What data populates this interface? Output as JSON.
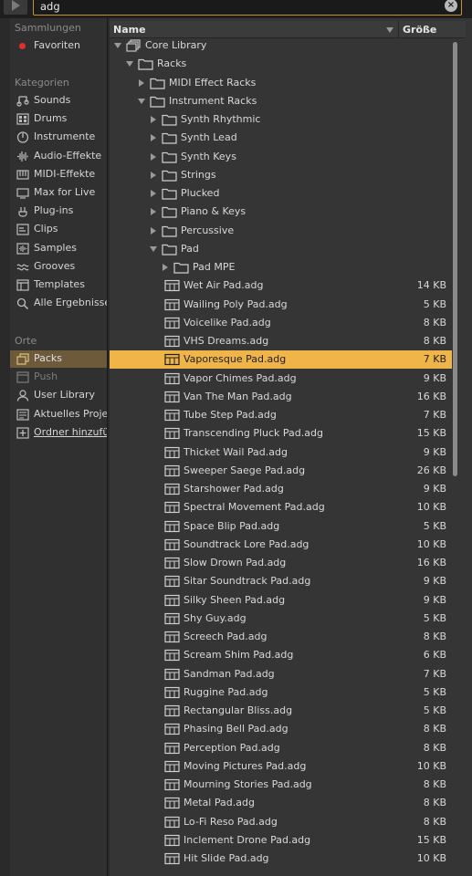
{
  "search": {
    "value": "adg"
  },
  "sidebar": {
    "sammlungen_head": "Sammlungen",
    "favoriten": "Favoriten",
    "kategorien_head": "Kategorien",
    "categories": [
      {
        "label": "Sounds",
        "icon": "sounds-icon"
      },
      {
        "label": "Drums",
        "icon": "drums-icon"
      },
      {
        "label": "Instrumente",
        "icon": "instruments-icon"
      },
      {
        "label": "Audio-Effekte",
        "icon": "audio-effects-icon"
      },
      {
        "label": "MIDI-Effekte",
        "icon": "midi-effects-icon"
      },
      {
        "label": "Max for Live",
        "icon": "max-for-live-icon"
      },
      {
        "label": "Plug-ins",
        "icon": "plugins-icon"
      },
      {
        "label": "Clips",
        "icon": "clips-icon"
      },
      {
        "label": "Samples",
        "icon": "samples-icon"
      },
      {
        "label": "Grooves",
        "icon": "grooves-icon"
      },
      {
        "label": "Templates",
        "icon": "templates-icon"
      },
      {
        "label": "Alle Ergebnisse",
        "icon": "search-icon"
      }
    ],
    "orte_head": "Orte",
    "places": [
      {
        "label": "Packs",
        "icon": "packs-icon"
      },
      {
        "label": "Push",
        "icon": "push-icon"
      },
      {
        "label": "User Library",
        "icon": "user-library-icon"
      },
      {
        "label": "Aktuelles Projekt",
        "icon": "current-project-icon"
      },
      {
        "label": "Ordner hinzufügen",
        "icon": "add-folder-icon"
      }
    ]
  },
  "columns": {
    "name": "Name",
    "size": "Größe"
  },
  "rows": [
    {
      "name": "Core Library",
      "size": "",
      "level": 0,
      "type": "library",
      "expanded": true
    },
    {
      "name": "Racks",
      "size": "",
      "level": 1,
      "type": "folder",
      "expanded": true
    },
    {
      "name": "MIDI Effect Racks",
      "size": "",
      "level": 2,
      "type": "folder",
      "expanded": false
    },
    {
      "name": "Instrument Racks",
      "size": "",
      "level": 2,
      "type": "folder",
      "expanded": true
    },
    {
      "name": "Synth Rhythmic",
      "size": "",
      "level": 3,
      "type": "folder",
      "expanded": false
    },
    {
      "name": "Synth Lead",
      "size": "",
      "level": 3,
      "type": "folder",
      "expanded": false
    },
    {
      "name": "Synth Keys",
      "size": "",
      "level": 3,
      "type": "folder",
      "expanded": false
    },
    {
      "name": "Strings",
      "size": "",
      "level": 3,
      "type": "folder",
      "expanded": false
    },
    {
      "name": "Plucked",
      "size": "",
      "level": 3,
      "type": "folder",
      "expanded": false
    },
    {
      "name": "Piano & Keys",
      "size": "",
      "level": 3,
      "type": "folder",
      "expanded": false
    },
    {
      "name": "Percussive",
      "size": "",
      "level": 3,
      "type": "folder",
      "expanded": false
    },
    {
      "name": "Pad",
      "size": "",
      "level": 3,
      "type": "folder",
      "expanded": true
    },
    {
      "name": "Pad MPE",
      "size": "",
      "level": 4,
      "type": "folder",
      "expanded": false
    },
    {
      "name": "Wet Air Pad.adg",
      "size": "14 KB",
      "level": 4,
      "type": "file"
    },
    {
      "name": "Wailing Poly Pad.adg",
      "size": "5 KB",
      "level": 4,
      "type": "file"
    },
    {
      "name": "Voicelike Pad.adg",
      "size": "8 KB",
      "level": 4,
      "type": "file"
    },
    {
      "name": "VHS Dreams.adg",
      "size": "8 KB",
      "level": 4,
      "type": "file"
    },
    {
      "name": "Vaporesque Pad.adg",
      "size": "7 KB",
      "level": 4,
      "type": "file",
      "selected": true
    },
    {
      "name": "Vapor Chimes Pad.adg",
      "size": "9 KB",
      "level": 4,
      "type": "file"
    },
    {
      "name": "Van The Man Pad.adg",
      "size": "16 KB",
      "level": 4,
      "type": "file"
    },
    {
      "name": "Tube Step Pad.adg",
      "size": "7 KB",
      "level": 4,
      "type": "file"
    },
    {
      "name": "Transcending Pluck Pad.adg",
      "size": "15 KB",
      "level": 4,
      "type": "file"
    },
    {
      "name": "Thicket Wail Pad.adg",
      "size": "9 KB",
      "level": 4,
      "type": "file"
    },
    {
      "name": "Sweeper Saege Pad.adg",
      "size": "26 KB",
      "level": 4,
      "type": "file"
    },
    {
      "name": "Starshower Pad.adg",
      "size": "9 KB",
      "level": 4,
      "type": "file"
    },
    {
      "name": "Spectral Movement Pad.adg",
      "size": "10 KB",
      "level": 4,
      "type": "file"
    },
    {
      "name": "Space Blip Pad.adg",
      "size": "5 KB",
      "level": 4,
      "type": "file"
    },
    {
      "name": "Soundtrack Lore Pad.adg",
      "size": "10 KB",
      "level": 4,
      "type": "file"
    },
    {
      "name": "Slow Drown Pad.adg",
      "size": "16 KB",
      "level": 4,
      "type": "file"
    },
    {
      "name": "Sitar Soundtrack Pad.adg",
      "size": "9 KB",
      "level": 4,
      "type": "file"
    },
    {
      "name": "Silky Sheen Pad.adg",
      "size": "9 KB",
      "level": 4,
      "type": "file"
    },
    {
      "name": "Shy Guy.adg",
      "size": "5 KB",
      "level": 4,
      "type": "file"
    },
    {
      "name": "Screech Pad.adg",
      "size": "8 KB",
      "level": 4,
      "type": "file"
    },
    {
      "name": "Scream Shim Pad.adg",
      "size": "6 KB",
      "level": 4,
      "type": "file"
    },
    {
      "name": "Sandman Pad.adg",
      "size": "7 KB",
      "level": 4,
      "type": "file"
    },
    {
      "name": "Ruggine Pad.adg",
      "size": "5 KB",
      "level": 4,
      "type": "file"
    },
    {
      "name": "Rectangular Bliss.adg",
      "size": "5 KB",
      "level": 4,
      "type": "file"
    },
    {
      "name": "Phasing Bell Pad.adg",
      "size": "8 KB",
      "level": 4,
      "type": "file"
    },
    {
      "name": "Perception Pad.adg",
      "size": "8 KB",
      "level": 4,
      "type": "file"
    },
    {
      "name": "Moving Pictures Pad.adg",
      "size": "10 KB",
      "level": 4,
      "type": "file"
    },
    {
      "name": "Mourning Stories Pad.adg",
      "size": "8 KB",
      "level": 4,
      "type": "file"
    },
    {
      "name": "Metal Pad.adg",
      "size": "8 KB",
      "level": 4,
      "type": "file"
    },
    {
      "name": "Lo-Fi Reso Pad.adg",
      "size": "8 KB",
      "level": 4,
      "type": "file"
    },
    {
      "name": "Inclement Drone Pad.adg",
      "size": "15 KB",
      "level": 4,
      "type": "file"
    },
    {
      "name": "Hit Slide Pad.adg",
      "size": "10 KB",
      "level": 4,
      "type": "file"
    }
  ],
  "colors": {
    "accent": "#f0b548",
    "favorite_dot": "#e0302a",
    "selected_place": "#6c5a3a"
  }
}
